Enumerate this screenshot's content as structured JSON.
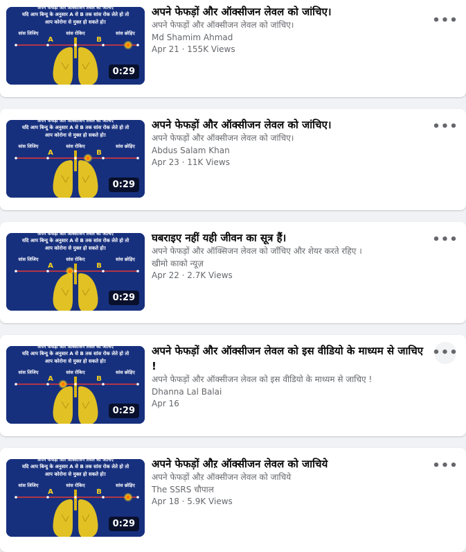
{
  "videos": [
    {
      "title": "अपने फेफड़ों और ऑक्सीजन लेवल को जांचिए।",
      "description": "अपने फेफड़ों और ऑक्सीजन लेवल को जांचिए।",
      "author": "Md Shamim Ahmad",
      "meta": "Apr 21 · 155K Views",
      "duration": "0:29"
    },
    {
      "title": "अपने फेफड़ों और ऑक्सीजन लेवल को जांचिए।",
      "description": "अपने फेफड़ों और ऑक्सीजन लेवल को जांचिए।",
      "author": "Abdus Salam Khan",
      "meta": "Apr 23 · 11K Views",
      "duration": "0:29"
    },
    {
      "title": "घबराइए नहीं यही जीवन का सूत्र हैं।",
      "description": "अपने फेफड़ों और ऑक्सिजन लेवल को जाँचिए और शेयर करते रहिए ।",
      "author": "खीमो काको न्यूज़",
      "meta": "Apr 22 · 2.7K Views",
      "duration": "0:29"
    },
    {
      "title": "अपने फेफड़ों और ऑक्सीजन लेवल को इस वीडियो के माध्यम से जाचिए !",
      "description": "अपने फेफड़ों और ऑक्सीजन लेवल को इस वीडियो के माध्यम से जाचिए !",
      "author": "Dhanna Lal Balai",
      "meta": "Apr 16",
      "duration": "0:29"
    },
    {
      "title": "अपने फेफड़ों औऱ ऑक्सीजन लेवल को जाचिये",
      "description": "अपने फेफड़ों औऱ ऑक्सीजन लेवल को जाचिये",
      "author": "The SSRS चौपाल",
      "meta": "Apr 18 · 5.9K Views",
      "duration": "0:29"
    }
  ],
  "thumbnail": {
    "top_text": "अपने फेफड़ों और ऑक्सीजन लेवल को जांचिए",
    "line1": "यदि आप बिन्दु के अनुसार A से B तक सांस रोक लेते हो तो",
    "line2": "आप कोरोना से मुक्त हो सकते हो!",
    "label_left": "सांस लिजिए",
    "label_mid": "सांस रोकिए",
    "label_right": "सांस छोड़िए",
    "point_a": "A",
    "point_b": "B"
  },
  "more_icon": "more-horizontal-icon",
  "colors": {
    "thumbnail_bg": "#17307e",
    "accent_yellow": "#f7d21b",
    "timeline_red": "#e53935"
  }
}
